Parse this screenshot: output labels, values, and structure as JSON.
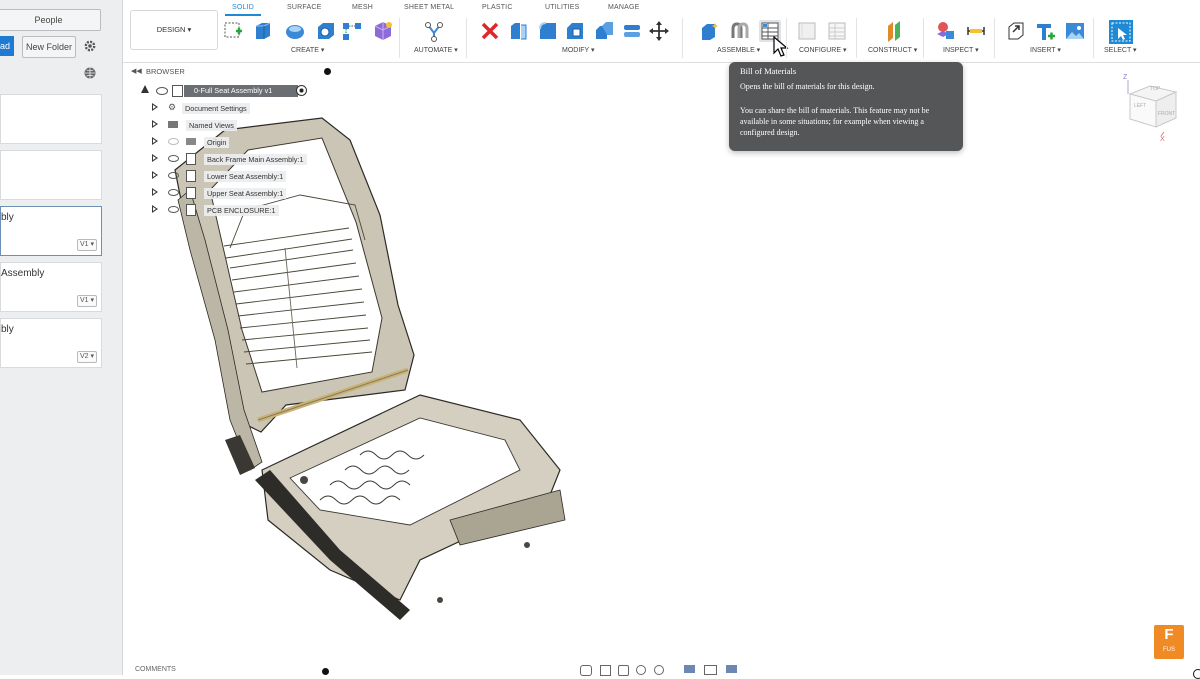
{
  "left_panel": {
    "people_label": "People",
    "upload_label": "ad",
    "new_folder_label": "New Folder",
    "items": [
      {
        "title": "",
        "version": ""
      },
      {
        "title": "",
        "version": ""
      },
      {
        "title": "bly",
        "version": "V1 ▾"
      },
      {
        "title": "Assembly",
        "version": "V1 ▾"
      },
      {
        "title": "bly",
        "version": "V2 ▾"
      }
    ]
  },
  "toolbar": {
    "workspace": "DESIGN ▾",
    "tabs": [
      "SOLID",
      "SURFACE",
      "MESH",
      "SHEET METAL",
      "PLASTIC",
      "UTILITIES",
      "MANAGE"
    ],
    "active_tab": "SOLID",
    "groups": [
      "CREATE ▾",
      "AUTOMATE ▾",
      "MODIFY ▾",
      "ASSEMBLE ▾",
      "CONFIGURE ▾",
      "CONSTRUCT ▾",
      "INSPECT ▾",
      "INSERT ▾",
      "SELECT ▾"
    ]
  },
  "tooltip": {
    "title": "Bill of Materials",
    "line1": "Opens the bill of materials for this design.",
    "line2": "You can share the bill of materials. This feature may not be available in some situations; for example when viewing a configured design."
  },
  "browser": {
    "header": "BROWSER",
    "root": "0-Full Seat Assembly v1",
    "items": [
      "Document Settings",
      "Named Views",
      "Origin",
      "Back Frame Main Assembly:1",
      "Lower Seat Assembly:1",
      "Upper Seat Assembly:1",
      "PCB ENCLOSURE:1"
    ]
  },
  "viewcube": {
    "top": "TOP",
    "left": "LEFT",
    "front": "FRONT",
    "x": "X",
    "z": "Z"
  },
  "bottom": {
    "comments": "COMMENTS"
  },
  "logo": {
    "letter": "F",
    "text": "FUS"
  },
  "colors": {
    "accent": "#1d8ad6",
    "tooltip_bg": "#545658",
    "logo": "#f08a24"
  }
}
